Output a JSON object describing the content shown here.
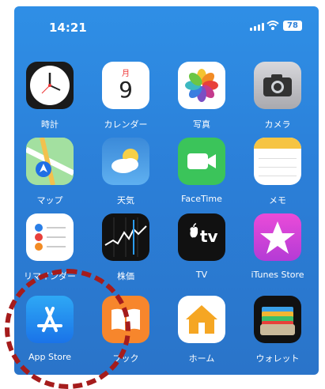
{
  "status_bar": {
    "time": "14:21",
    "battery": "78"
  },
  "apps": [
    {
      "id": "clock",
      "label": "時計"
    },
    {
      "id": "calendar",
      "label": "カレンダー",
      "month": "月",
      "day": "9"
    },
    {
      "id": "photos",
      "label": "写真"
    },
    {
      "id": "camera",
      "label": "カメラ"
    },
    {
      "id": "maps",
      "label": "マップ"
    },
    {
      "id": "weather",
      "label": "天気"
    },
    {
      "id": "facetime",
      "label": "FaceTime"
    },
    {
      "id": "notes",
      "label": "メモ"
    },
    {
      "id": "reminders",
      "label": "リマインダー"
    },
    {
      "id": "stocks",
      "label": "株価"
    },
    {
      "id": "tv",
      "label": "TV",
      "icon_text": "tv"
    },
    {
      "id": "itunes",
      "label": "iTunes Store"
    },
    {
      "id": "appstore",
      "label": "App Store"
    },
    {
      "id": "books",
      "label": "ブック"
    },
    {
      "id": "home",
      "label": "ホーム"
    },
    {
      "id": "wallet",
      "label": "ウォレット"
    }
  ],
  "highlight_color": "#a51c1c"
}
